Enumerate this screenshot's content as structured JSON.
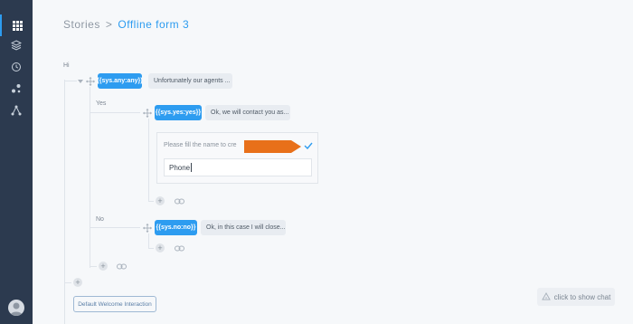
{
  "sidebar": {
    "items": [
      {
        "icon": "grid-icon"
      },
      {
        "icon": "layers-icon"
      },
      {
        "icon": "history-icon"
      },
      {
        "icon": "nodes-icon"
      },
      {
        "icon": "share-icon"
      }
    ],
    "avatar": "avatar"
  },
  "breadcrumb": {
    "root": "Stories",
    "separator": ">",
    "current": "Offline form 3"
  },
  "flow": {
    "start_label": "Hi",
    "root_node": {
      "intent": "{{sys.any:any}}",
      "response": "Unfortunately our agents ..."
    },
    "yes_branch": {
      "label": "Yes",
      "intent": "{{sys.yes:yes}}",
      "response": "Ok, we will contact you as..."
    },
    "form_panel": {
      "prompt": "Please fill the name to cre",
      "field_value": "Phone"
    },
    "no_branch": {
      "label": "No",
      "intent": "{{sys.no:no}}",
      "response": "Ok, in this case I will close..."
    },
    "default_button": "Default Welcome Interaction"
  },
  "chat": {
    "label": "click to show chat"
  },
  "colors": {
    "accent": "#2d9cf0",
    "sidebar": "#2c3a4f",
    "flag": "#e8701a"
  }
}
